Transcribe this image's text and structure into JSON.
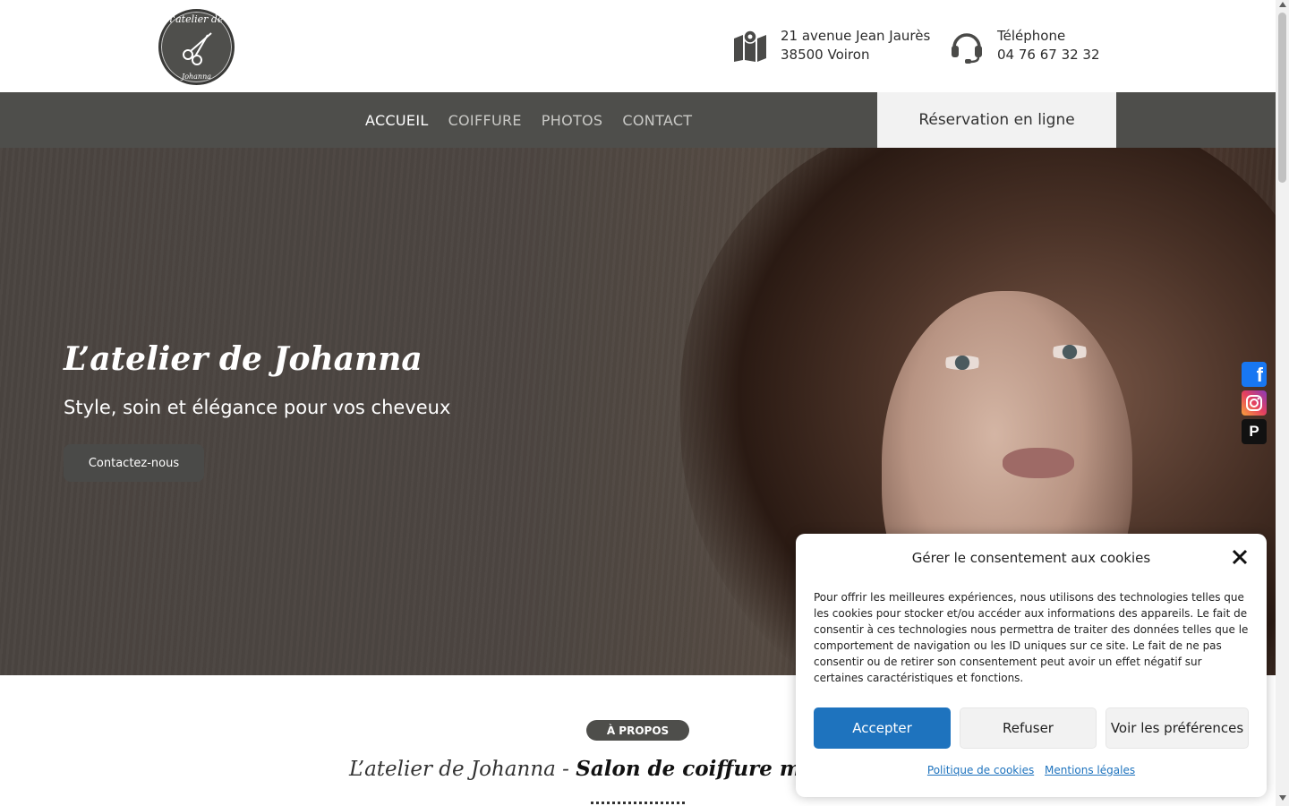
{
  "header": {
    "logo_text_top": "l'atelier de",
    "logo_text_bottom": "Johanna",
    "address_line1": "21 avenue Jean Jaurès",
    "address_line2": "38500 Voiron",
    "phone_label": "Téléphone",
    "phone_number": "04 76 67 32 32"
  },
  "nav": {
    "items": [
      {
        "label": "ACCUEIL",
        "active": true
      },
      {
        "label": "COIFFURE",
        "active": false
      },
      {
        "label": "PHOTOS",
        "active": false
      },
      {
        "label": "CONTACT",
        "active": false
      }
    ],
    "reservation_label": "Réservation en ligne"
  },
  "hero": {
    "title": "L’atelier de Johanna",
    "subtitle": "Style, soin et élégance pour vos cheveux",
    "button_label": "Contactez-nous"
  },
  "social": [
    {
      "name": "facebook-icon",
      "glyph": "f",
      "color": "#1877f2"
    },
    {
      "name": "instagram-icon",
      "glyph": "",
      "color": "#e4405f"
    },
    {
      "name": "planity-icon",
      "glyph": "P",
      "color": "#111111"
    }
  ],
  "about": {
    "badge": "À PROPOS",
    "title_part1": "L’atelier de Johanna",
    "title_sep": " - ",
    "title_part2": "Salon de coiffure moderne et"
  },
  "cookie": {
    "title": "Gérer le consentement aux cookies",
    "text": "Pour offrir les meilleures expériences, nous utilisons des technologies telles que les cookies pour stocker et/ou accéder aux informations des appareils. Le fait de consentir à ces technologies nous permettra de traiter des données telles que le comportement de navigation ou les ID uniques sur ce site. Le fait de ne pas consentir ou de retirer son consentement peut avoir un effet négatif sur certaines caractéristiques et fonctions.",
    "accept_label": "Accepter",
    "refuse_label": "Refuser",
    "prefs_label": "Voir les préférences",
    "link_policy": "Politique de cookies",
    "link_legal": "Mentions légales"
  },
  "colors": {
    "nav_bg": "#4e4e4b",
    "accent_blue": "#1e73be",
    "reservation_bg": "#f2f2f2"
  }
}
